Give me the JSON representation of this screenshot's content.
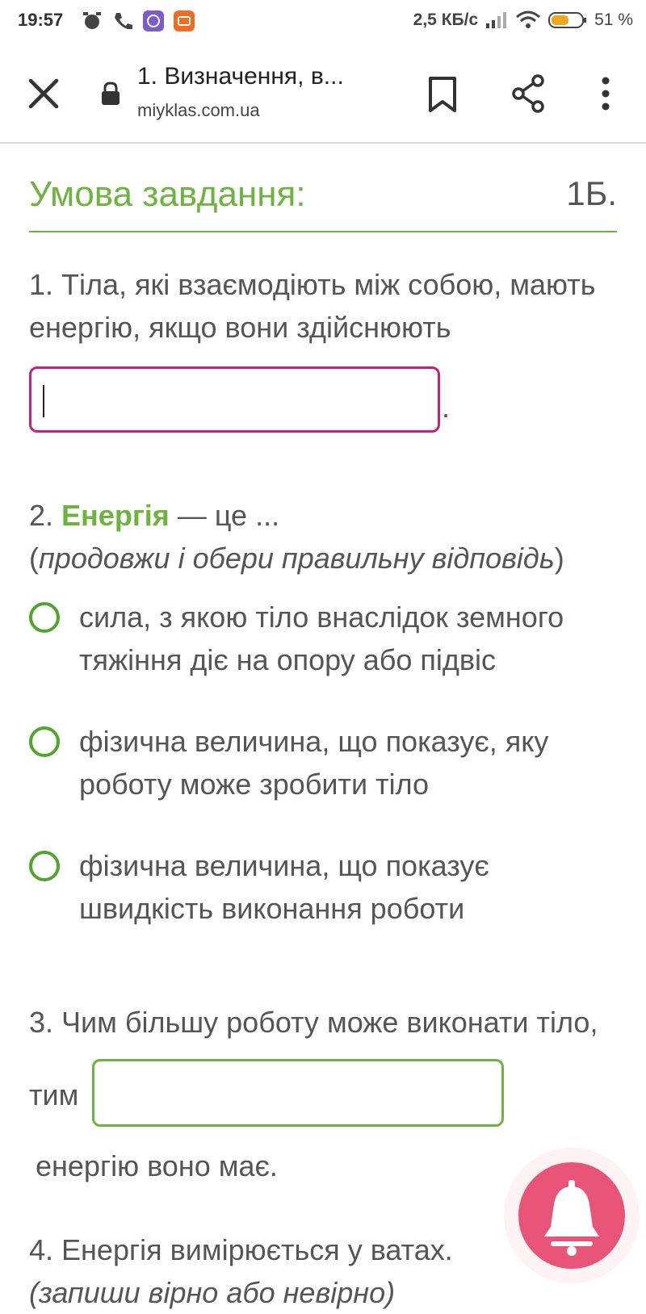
{
  "status": {
    "time": "19:57",
    "speed": "2,5 КБ/с",
    "battery": "51 %"
  },
  "toolbar": {
    "title": "1. Визначення, в...",
    "url": "miyklas.com.ua"
  },
  "header": {
    "title": "Умова завдання:",
    "points": "1Б."
  },
  "q1": {
    "text": "1. Тіла, які взаємодіють між собою, мають енергію, якщо вони здійснюють",
    "suffix": "."
  },
  "q2": {
    "number": "2.",
    "keyword": "Енергія",
    "rest": " — це ...",
    "hint_open": "(",
    "hint": "продовжи і обери правильну відповідь",
    "hint_close": ")",
    "options": [
      "сила, з якою тіло внаслідок земного тяжіння діє на опору або підвіс",
      "фізична величина, що показує, яку роботу може зробити тіло",
      "фізична величина, що показує швидкість виконання роботи"
    ]
  },
  "q3": {
    "number": "3.",
    "text": " Чим більшу роботу може виконати тіло,",
    "prefix": "тим",
    "suffix": "енергію воно має."
  },
  "q4": {
    "number": "4.",
    "text": " Енергія вимірюється у ватах.",
    "hint_partial": "(запиши вірно або невірно)"
  },
  "colors": {
    "accent_green": "#6db33f",
    "input_pink": "#c0237f",
    "bell_pink": "#e85378"
  }
}
